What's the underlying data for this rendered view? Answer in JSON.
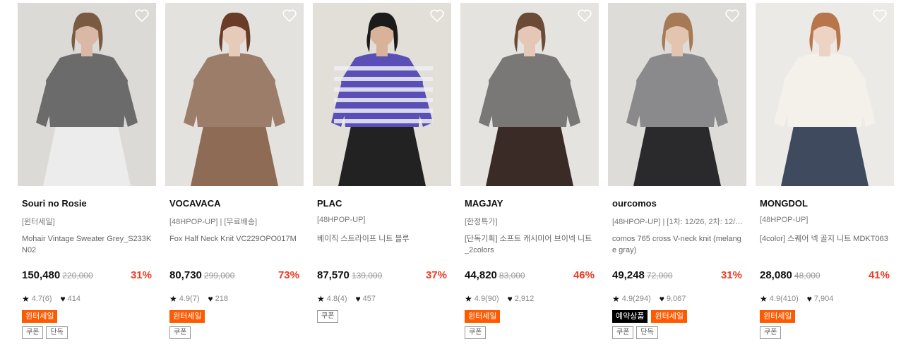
{
  "products": [
    {
      "brand": "Souri no Rosie",
      "tagline": "[윈터세일]",
      "name": "Mohair Vintage Sweater Grey_S233KN02",
      "price": "150,480",
      "original_price": "220,000",
      "discount": "31%",
      "rating": "4.7(6)",
      "likes": "414",
      "badges": [
        {
          "label": "윈터세일",
          "style": "orange"
        }
      ],
      "chips": [
        "쿠폰",
        "단독"
      ],
      "image": {
        "bg": "#dcdad6",
        "top": "#6b6b6b",
        "bottom": "#ececec",
        "skin": "#d9b9a6",
        "hair": "#7a5a40"
      }
    },
    {
      "brand": "VOCAVACA",
      "tagline": "[48HPOP-UP] | [무료배송]",
      "name": "Fox Half Neck Knit VC229OPO017M",
      "price": "80,730",
      "original_price": "299,000",
      "discount": "73%",
      "rating": "4.9(7)",
      "likes": "218",
      "badges": [
        {
          "label": "윈터세일",
          "style": "orange"
        }
      ],
      "chips": [
        "쿠폰"
      ],
      "image": {
        "bg": "#e4e2df",
        "top": "#9c7d69",
        "bottom": "#8e6b55",
        "skin": "#e6cbbb",
        "hair": "#6a3b26"
      }
    },
    {
      "brand": "PLAC",
      "tagline": "[48HPOP-UP]",
      "name": "베이직 스트라이프 니트 블루",
      "price": "87,570",
      "original_price": "139,000",
      "discount": "37%",
      "rating": "4.8(4)",
      "likes": "457",
      "badges": [],
      "chips": [
        "쿠폰"
      ],
      "image": {
        "bg": "#e2ded8",
        "top": "#5a4fb6",
        "stripe": "#eeeef4",
        "bottom": "#222222",
        "skin": "#d8b39a",
        "hair": "#1b1b1b"
      }
    },
    {
      "brand": "MAGJAY",
      "tagline": "[한정특가]",
      "name": "[단독기획] 소프트 캐시미어 브이넥 니트_2colors",
      "price": "44,820",
      "original_price": "83,000",
      "discount": "46%",
      "rating": "4.9(90)",
      "likes": "2,912",
      "badges": [
        {
          "label": "윈터세일",
          "style": "orange"
        }
      ],
      "chips": [
        "쿠폰"
      ],
      "image": {
        "bg": "#e5e3e0",
        "top": "#7a7877",
        "bottom": "#3a2b27",
        "skin": "#e4c7b6",
        "hair": "#6b4a36"
      }
    },
    {
      "brand": "ourcomos",
      "tagline": "[48HPOP-UP] | [1차: 12/26, 2차: 12/…",
      "name": "comos 765 cross V-neck knit (melange gray)",
      "price": "49,248",
      "original_price": "72,000",
      "discount": "31%",
      "rating": "4.9(294)",
      "likes": "9,067",
      "badges": [
        {
          "label": "예약상품",
          "style": "black"
        },
        {
          "label": "윈터세일",
          "style": "orange"
        }
      ],
      "chips": [
        "쿠폰",
        "단독"
      ],
      "image": {
        "bg": "#dedcd9",
        "top": "#8a8a8c",
        "bottom": "#2a2a2c",
        "skin": "#e2c4b0",
        "hair": "#a57a55"
      }
    },
    {
      "brand": "MONGDOL",
      "tagline": "[48HPOP-UP]",
      "name": "[4color] 스퀘어 넥 골지 니트 MDKT063",
      "price": "28,080",
      "original_price": "48,000",
      "discount": "41%",
      "rating": "4.9(410)",
      "likes": "7,904",
      "badges": [
        {
          "label": "윈터세일",
          "style": "orange"
        }
      ],
      "chips": [
        "쿠폰"
      ],
      "image": {
        "bg": "#eceae7",
        "top": "#f4f1ea",
        "bottom": "#3f4a5e",
        "skin": "#ecd3c4",
        "hair": "#b8754a"
      }
    }
  ],
  "icons": {
    "wishlist": "heart-outline-icon",
    "rating": "star-icon",
    "likes": "heart-icon"
  }
}
